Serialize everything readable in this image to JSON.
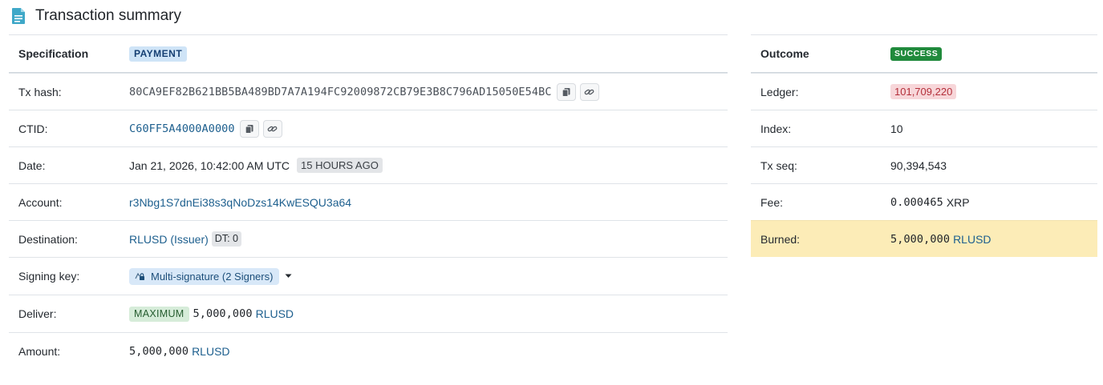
{
  "page": {
    "title": "Transaction summary",
    "icon": "document-icon"
  },
  "left": {
    "specification_label": "Specification",
    "type_badge": "PAYMENT",
    "tx_hash_label": "Tx hash:",
    "tx_hash": "80CA9EF82B621BB5BA489BD7A7A194FC92009872CB79E3B8C796AD15050E54BC",
    "ctid_label": "CTID:",
    "ctid": "C60FF5A4000A0000",
    "date_label": "Date:",
    "date": "Jan 21, 2026, 10:42:00 AM UTC",
    "date_ago": "15 HOURS AGO",
    "account_label": "Account:",
    "account": "r3Nbg1S7dnEi38s3qNoDzs14KwESQU3a64",
    "destination_label": "Destination:",
    "destination": "RLUSD (Issuer)",
    "destination_tag": "DT: 0",
    "signing_key_label": "Signing key:",
    "signing_key": "Multi-signature (2 Signers)",
    "deliver_label": "Deliver:",
    "deliver_badge": "MAXIMUM",
    "deliver_amount": "5,000,000",
    "deliver_currency": "RLUSD",
    "amount_label": "Amount:",
    "amount": "5,000,000",
    "amount_currency": "RLUSD"
  },
  "right": {
    "outcome_label": "Outcome",
    "outcome_badge": "SUCCESS",
    "ledger_label": "Ledger:",
    "ledger": "101,709,220",
    "index_label": "Index:",
    "index": "10",
    "tx_seq_label": "Tx seq:",
    "tx_seq": "90,394,543",
    "fee_label": "Fee:",
    "fee": "0.000465",
    "fee_currency": "XRP",
    "burned_label": "Burned:",
    "burned": "5,000,000",
    "burned_currency": "RLUSD"
  },
  "colors": {
    "link": "#1d5f8e",
    "success": "#208a3c",
    "payment_badge": "#cfe4f7",
    "burned_highlight": "#fcecb7",
    "ledger_badge": "#f7d6d9"
  }
}
